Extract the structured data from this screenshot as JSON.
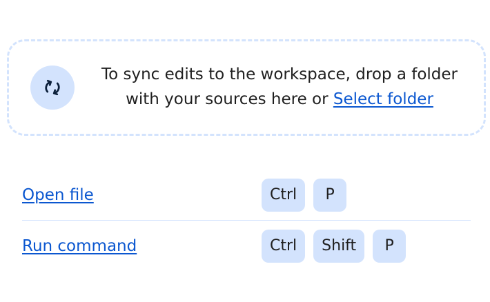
{
  "dropzone": {
    "icon": "sync-icon",
    "text": "To sync edits to the workspace, drop a folder with your sources here or ",
    "select_folder_label": "Select folder"
  },
  "shortcuts": [
    {
      "label": "Open file",
      "keys": [
        "Ctrl",
        "P"
      ]
    },
    {
      "label": "Run command",
      "keys": [
        "Ctrl",
        "Shift",
        "P"
      ]
    }
  ],
  "colors": {
    "accent": "#0b57d0",
    "badge_bg": "#d3e3fd",
    "border": "#d3e3fd",
    "text": "#1f1f1f"
  }
}
